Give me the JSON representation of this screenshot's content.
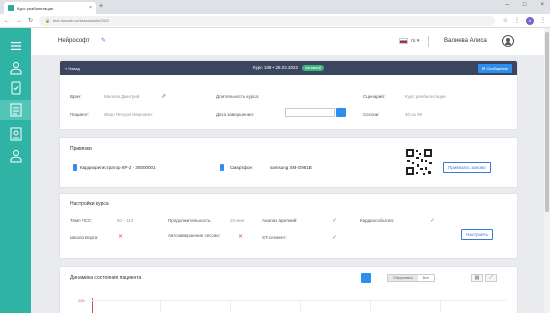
{
  "browser": {
    "tab_title": "Курс реабилитации",
    "url": "test.domain.ru/sessions/id/2022"
  },
  "sidebar": {
    "items": [
      {
        "icon": "menu-icon"
      },
      {
        "icon": "patients-icon"
      },
      {
        "icon": "phone-device-icon"
      },
      {
        "icon": "sessions-icon"
      },
      {
        "icon": "documents-icon"
      },
      {
        "icon": "doctor-icon"
      }
    ]
  },
  "header": {
    "brand": "Нейрософт",
    "language": "ru",
    "user_name": "Валиева Алиса"
  },
  "session": {
    "back_label": "« Назад",
    "title": "Курс 188  •  28.03.2022",
    "status": "Активный",
    "message_button": "Сообщение",
    "doctor_label": "Врач:",
    "doctor_value": "Малков Дмитрий",
    "patient_label": "Пациент:",
    "patient_value": "Иван Петров Иванович",
    "duration_label": "Длительность курса:",
    "end_date_label": "Дата завершения:",
    "scenario_label": "Сценарий:",
    "scenario_value": "Курс реабилитации",
    "sessions_label": "Сессии:",
    "sessions_value": "40 из 90"
  },
  "bindings": {
    "title": "Привязки",
    "device1_label": "Кардиорегистратор КР-2 - 30000001",
    "device2_label": "Смартфон",
    "device2_value": "samsung SM-G981B",
    "bind_button": "Привязать заново"
  },
  "course_settings": {
    "title": "Настройки курса",
    "hr_label": "Темп ЧСС:",
    "hr_value": "90 - 110",
    "borg_label": "Шкала Борга:",
    "duration_label": "Продолжительность:",
    "duration_value": "25 мин",
    "autoend_label": "Автозавершение сессии:",
    "arrhythmia_label": "Анализ аритмий:",
    "st_label": "ST-сегмент:",
    "cardio_label": "Кардиособытия:",
    "configure_button": "Настроить"
  },
  "dynamics": {
    "title": "Динамика состояния пациента",
    "toggle_options": [
      "Оперативно",
      "Все"
    ],
    "y_max": "200"
  }
}
